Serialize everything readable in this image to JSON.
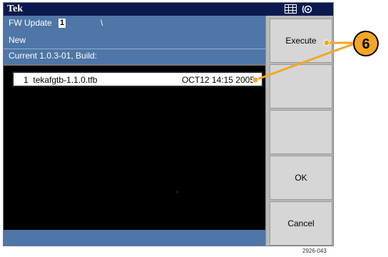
{
  "title_bar": {
    "brand": "Tek",
    "icons": [
      "grid-icon",
      "wave-icon"
    ]
  },
  "info": {
    "fw_update_label": "FW Update",
    "fw_update_value": "1",
    "slash_mark": "\\",
    "new_label": "New",
    "current_label": "Current  1.0.3-01, Build:"
  },
  "file_list": {
    "rows": [
      {
        "index": "1",
        "name": "tekafgtb-1.1.0.tfb",
        "date": "OCT12 14:15 2005"
      }
    ]
  },
  "softkeys": [
    "Execute",
    "",
    "",
    "OK",
    "Cancel"
  ],
  "callout": {
    "number": "6"
  },
  "figure_id": "2926-043",
  "colors": {
    "title_bar": "#0b1a4e",
    "info_panel": "#4e76a6",
    "softkey_bg": "#d6d6d6",
    "callout": "#f5a623"
  }
}
